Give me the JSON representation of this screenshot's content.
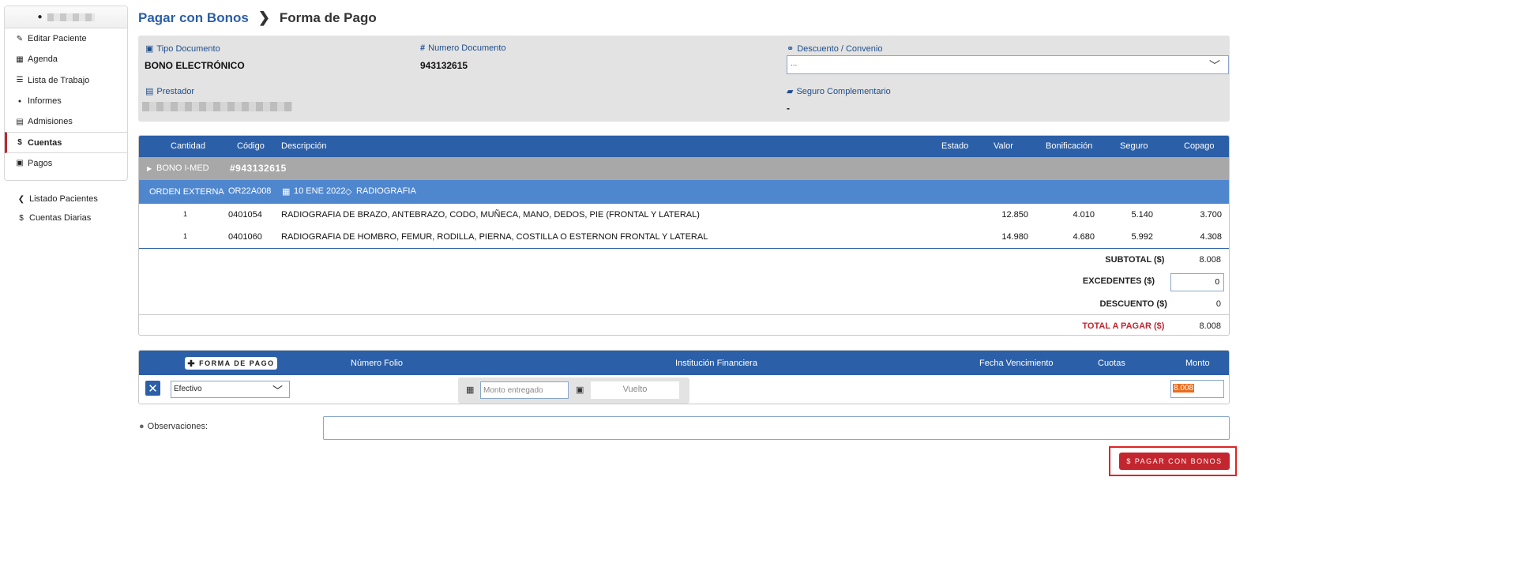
{
  "sidebar": {
    "items": [
      {
        "label": "Editar Paciente",
        "icon": "pencil-icon",
        "glyph": "✎"
      },
      {
        "label": "Agenda",
        "icon": "calendar-icon",
        "glyph": "▦"
      },
      {
        "label": "Lista de Trabajo",
        "icon": "list-icon",
        "glyph": "☰"
      },
      {
        "label": "Informes",
        "icon": "microphone-icon",
        "glyph": "●"
      },
      {
        "label": "Admisiones",
        "icon": "clipboard-icon",
        "glyph": "▤"
      },
      {
        "label": "Cuentas",
        "icon": "dollar-icon",
        "glyph": "$"
      },
      {
        "label": "Pagos",
        "icon": "money-icon",
        "glyph": "▣"
      }
    ],
    "links": [
      {
        "label": "Listado Pacientes",
        "icon": "chevron-left-icon",
        "glyph": "❮"
      },
      {
        "label": "Cuentas Diarias",
        "icon": "dollar-icon",
        "glyph": "$"
      }
    ]
  },
  "header": {
    "crumb": "Pagar con Bonos",
    "title": "Forma de Pago"
  },
  "info": {
    "tipo_label": "Tipo Documento",
    "tipo_value": "BONO ELECTRÓNICO",
    "numero_label": "Numero Documento",
    "numero_value": "943132615",
    "descuento_label": "Descuento / Convenio",
    "descuento_value": "...",
    "prestador_label": "Prestador",
    "seguro_label": "Seguro Complementario",
    "seguro_value": "-"
  },
  "table": {
    "headers": {
      "cantidad": "Cantidad",
      "codigo": "Código",
      "descripcion": "Descripción",
      "estado": "Estado",
      "valor": "Valor",
      "bonificacion": "Bonificación",
      "seguro": "Seguro",
      "copago": "Copago"
    },
    "bono": {
      "label": "BONO I-MED",
      "number": "#943132615"
    },
    "orden": {
      "label": "ORDEN EXTERNA",
      "code": "OR22A008",
      "date": "10 ENE 2022",
      "type": "RADIOGRAFIA"
    },
    "rows": [
      {
        "cantidad": "1",
        "codigo": "0401054",
        "descripcion": "RADIOGRAFIA DE BRAZO, ANTEBRAZO, CODO, MUÑECA, MANO, DEDOS, PIE (FRONTAL Y LATERAL)",
        "valor": "12.850",
        "bonificacion": "4.010",
        "seguro": "5.140",
        "copago": "3.700"
      },
      {
        "cantidad": "1",
        "codigo": "0401060",
        "descripcion": "RADIOGRAFIA DE HOMBRO, FEMUR, RODILLA, PIERNA, COSTILLA O ESTERNON FRONTAL Y LATERAL",
        "valor": "14.980",
        "bonificacion": "4.680",
        "seguro": "5.992",
        "copago": "4.308"
      }
    ]
  },
  "totals": {
    "subtotal_label": "SUBTOTAL ($)",
    "subtotal": "8.008",
    "excedentes_label": "EXCEDENTES ($)",
    "excedentes": "0",
    "descuento_label": "DESCUENTO ($)",
    "descuento": "0",
    "total_label": "TOTAL A PAGAR ($)",
    "total": "8.008"
  },
  "payment": {
    "add_label": "FORMA DE PAGO",
    "headers": {
      "folio": "Número Folio",
      "institucion": "Institución Financiera",
      "fecha": "Fecha Vencimiento",
      "cuotas": "Cuotas",
      "monto": "Monto"
    },
    "method": "Efectivo",
    "monto_placeholder": "Monto entregado",
    "vuelto_placeholder": "Vuelto",
    "amount": "8.008"
  },
  "observaciones_label": "Observaciones:",
  "pay_button_label": "PAGAR CON BONOS",
  "colors": {
    "primary": "#2b5fa8",
    "danger": "#c3262e",
    "row_light": "#4f87cf",
    "row_gray": "#a8a8a8"
  }
}
